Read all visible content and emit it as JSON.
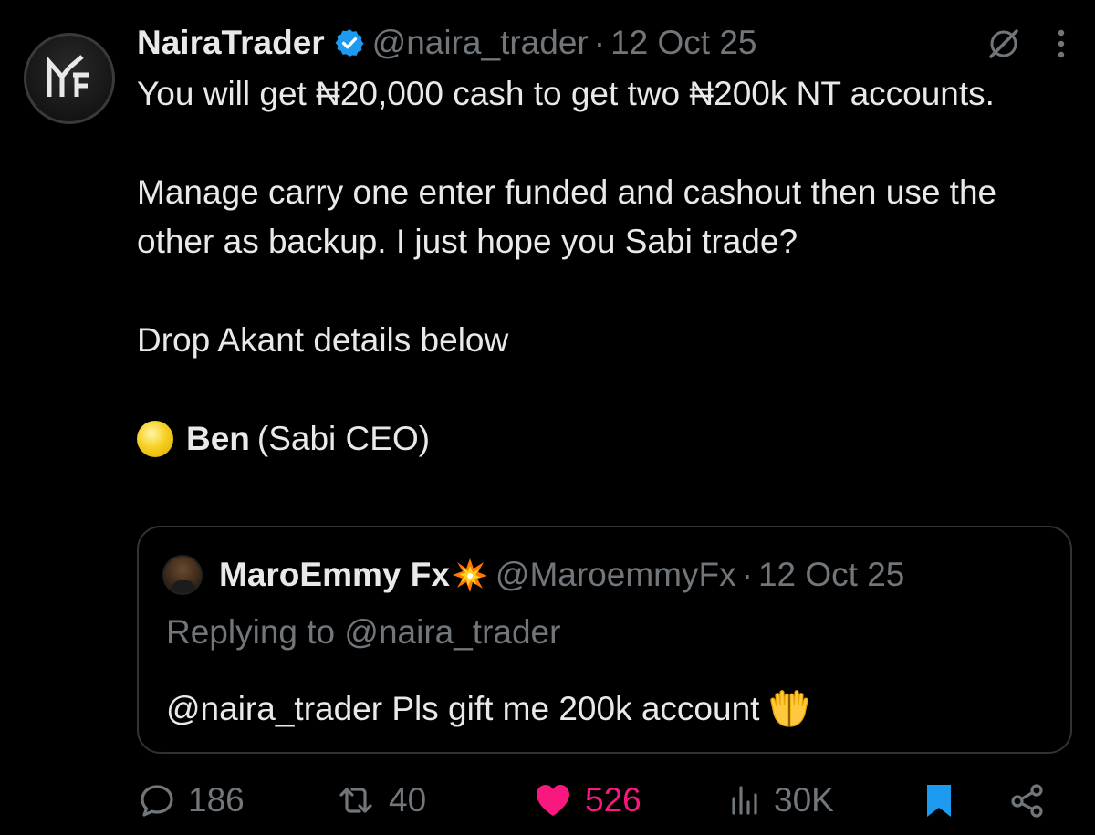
{
  "tweet": {
    "author": {
      "display_name": "NairaTrader",
      "handle": "@naira_trader",
      "avatar_icon": "naira-trader-logo-icon",
      "verified": true
    },
    "separator": "·",
    "date": "12 Oct 25",
    "paragraphs": [
      "You will get ₦20,000 cash to get two ₦200k NT accounts.",
      "Manage carry one enter funded and cashout then use the other as backup. I just hope you Sabi trade?",
      "Drop Akant details below"
    ],
    "signature": {
      "emoji_icon": "yellow-circle-icon",
      "name": "Ben",
      "title": "(Sabi CEO)"
    },
    "header_icons": [
      "grok-icon",
      "more-icon"
    ]
  },
  "quoted_tweet": {
    "display_name": "MaroEmmy Fx",
    "name_emoji_icon": "collision-icon",
    "handle": "@MaroemmyFx",
    "separator": "·",
    "date": "12 Oct 25",
    "replying_to": "Replying to @naira_trader",
    "text": "@naira_trader Pls gift me 200k account",
    "text_emoji_icon": "palms-up-together-icon"
  },
  "actions": {
    "replies": "186",
    "reposts": "40",
    "likes": "526",
    "views": "30K",
    "like_color": "#f91880",
    "bookmark_color": "#1d9bf0"
  },
  "colors": {
    "background": "#000000",
    "text": "#e7e9ea",
    "muted": "#71767b",
    "verified": "#1d9bf0",
    "border": "#2f3336"
  }
}
